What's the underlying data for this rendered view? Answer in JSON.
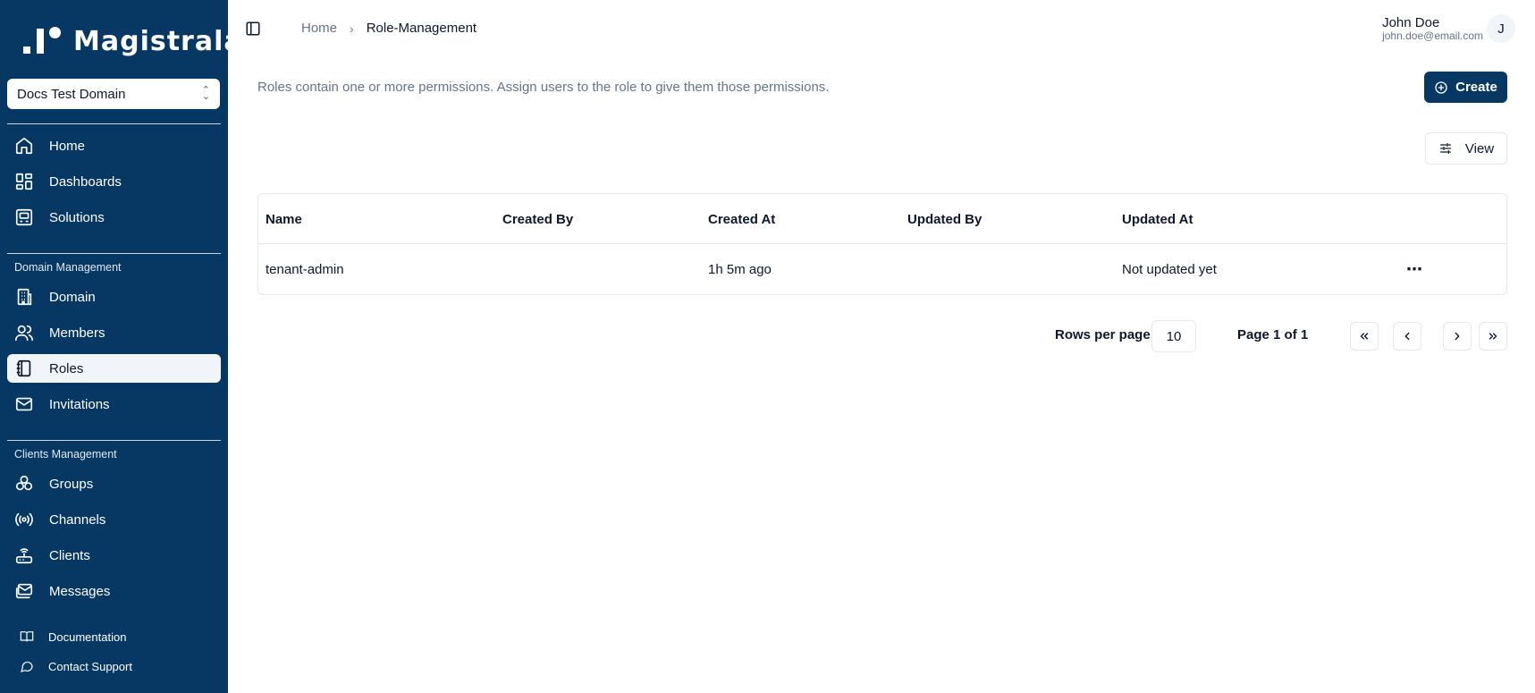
{
  "app": {
    "name": "Magistrala"
  },
  "domain_selector": {
    "value": "Docs Test Domain"
  },
  "sidebar": {
    "main_items": [
      {
        "label": "Home",
        "icon": "home-icon"
      },
      {
        "label": "Dashboards",
        "icon": "dashboard-icon"
      },
      {
        "label": "Solutions",
        "icon": "solutions-icon"
      }
    ],
    "domain_section_label": "Domain Management",
    "domain_items": [
      {
        "label": "Domain",
        "icon": "building-icon"
      },
      {
        "label": "Members",
        "icon": "users-icon"
      },
      {
        "label": "Roles",
        "icon": "notebook-icon",
        "active": true
      },
      {
        "label": "Invitations",
        "icon": "mail-icon"
      }
    ],
    "clients_section_label": "Clients Management",
    "clients_items": [
      {
        "label": "Groups",
        "icon": "groups-icon"
      },
      {
        "label": "Channels",
        "icon": "radio-icon"
      },
      {
        "label": "Clients",
        "icon": "router-icon"
      },
      {
        "label": "Messages",
        "icon": "messages-icon"
      }
    ],
    "footer_items": [
      {
        "label": "Documentation",
        "icon": "book-icon"
      },
      {
        "label": "Contact Support",
        "icon": "chat-icon"
      }
    ]
  },
  "breadcrumb": {
    "home": "Home",
    "current": "Role-Management"
  },
  "user": {
    "name": "John Doe",
    "email": "john.doe@email.com",
    "initial": "J"
  },
  "page": {
    "description": "Roles contain one or more permissions. Assign users to the role to give them those permissions.",
    "create_label": "Create",
    "view_label": "View"
  },
  "table": {
    "columns": [
      "Name",
      "Created By",
      "Created At",
      "Updated By",
      "Updated At"
    ],
    "rows": [
      {
        "name": "tenant-admin",
        "created_by": "",
        "created_at": "1h 5m ago",
        "updated_by": "",
        "updated_at": "Not updated yet",
        "actions": "⋯"
      }
    ]
  },
  "pagination": {
    "rows_per_page_label": "Rows per page",
    "rows_per_page": "10",
    "page_info": "Page 1 of 1"
  },
  "colors": {
    "sidebar": "#073763",
    "primary": "#073763",
    "muted_text": "#64748b",
    "border": "#e2e8f0"
  }
}
